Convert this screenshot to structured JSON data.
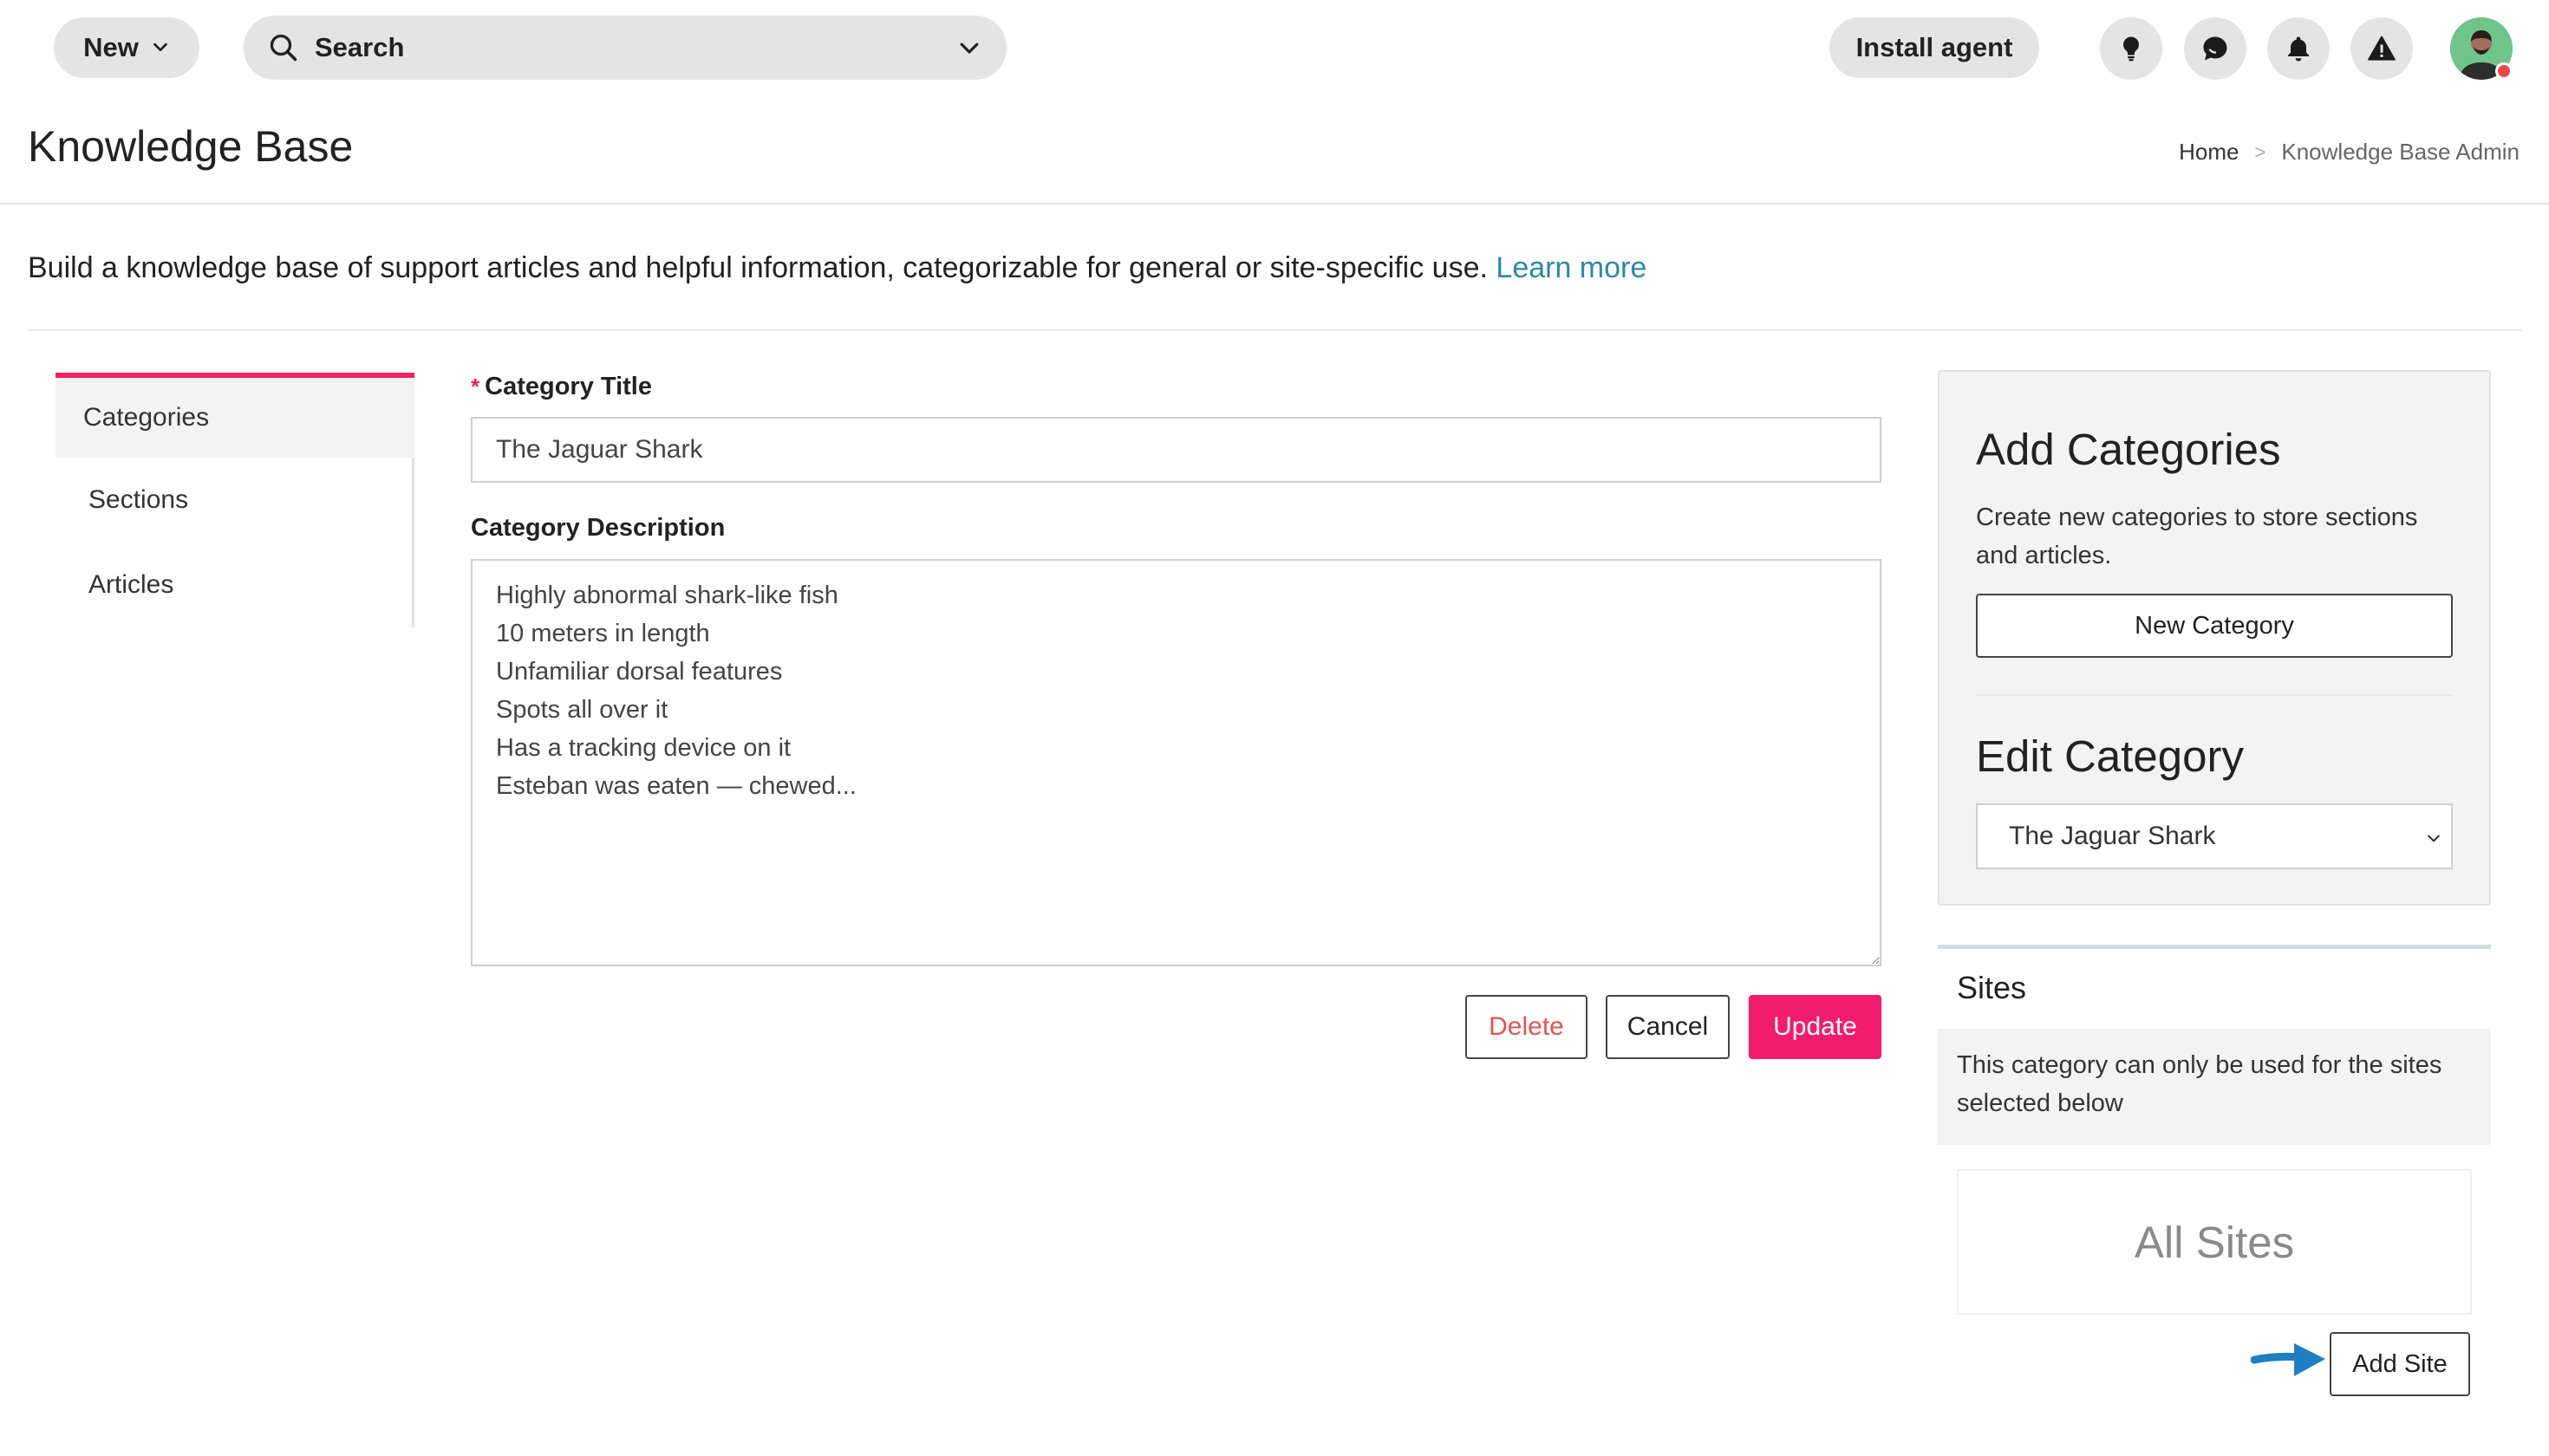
{
  "topbar": {
    "new_label": "New",
    "search_placeholder": "Search",
    "install_label": "Install agent",
    "icons": [
      "lightbulb-icon",
      "chat-icon",
      "bell-icon",
      "warning-icon"
    ]
  },
  "header": {
    "title": "Knowledge Base",
    "breadcrumb": {
      "home": "Home",
      "separator": ">",
      "current": "Knowledge Base Admin"
    }
  },
  "intro": {
    "text": "Build a knowledge base of support articles and helpful information, categorizable for general or site-specific use.",
    "link": "Learn more"
  },
  "nav": {
    "tabs": [
      "Categories",
      "Sections",
      "Articles"
    ],
    "active": "Categories"
  },
  "form": {
    "title_label": "Category Title",
    "required_mark": "*",
    "title_value": "The Jaguar Shark",
    "description_label": "Category Description",
    "description_value": "Highly abnormal shark-like fish\n10 meters in length\nUnfamiliar dorsal features\nSpots all over it\nHas a tracking device on it\nEsteban was eaten — chewed...",
    "delete_label": "Delete",
    "cancel_label": "Cancel",
    "update_label": "Update"
  },
  "panel": {
    "add_title": "Add Categories",
    "add_desc": "Create new categories to store sections and articles.",
    "new_category_label": "New Category",
    "edit_title": "Edit Category",
    "edit_selected": "The Jaguar Shark"
  },
  "sites": {
    "title": "Sites",
    "note": "This category can only be used for the sites selected below",
    "all_sites": "All Sites",
    "add_site_label": "Add Site"
  },
  "colors": {
    "accent": "#f21c6c",
    "link": "#2b88a8",
    "arrow": "#1f7fc0"
  }
}
